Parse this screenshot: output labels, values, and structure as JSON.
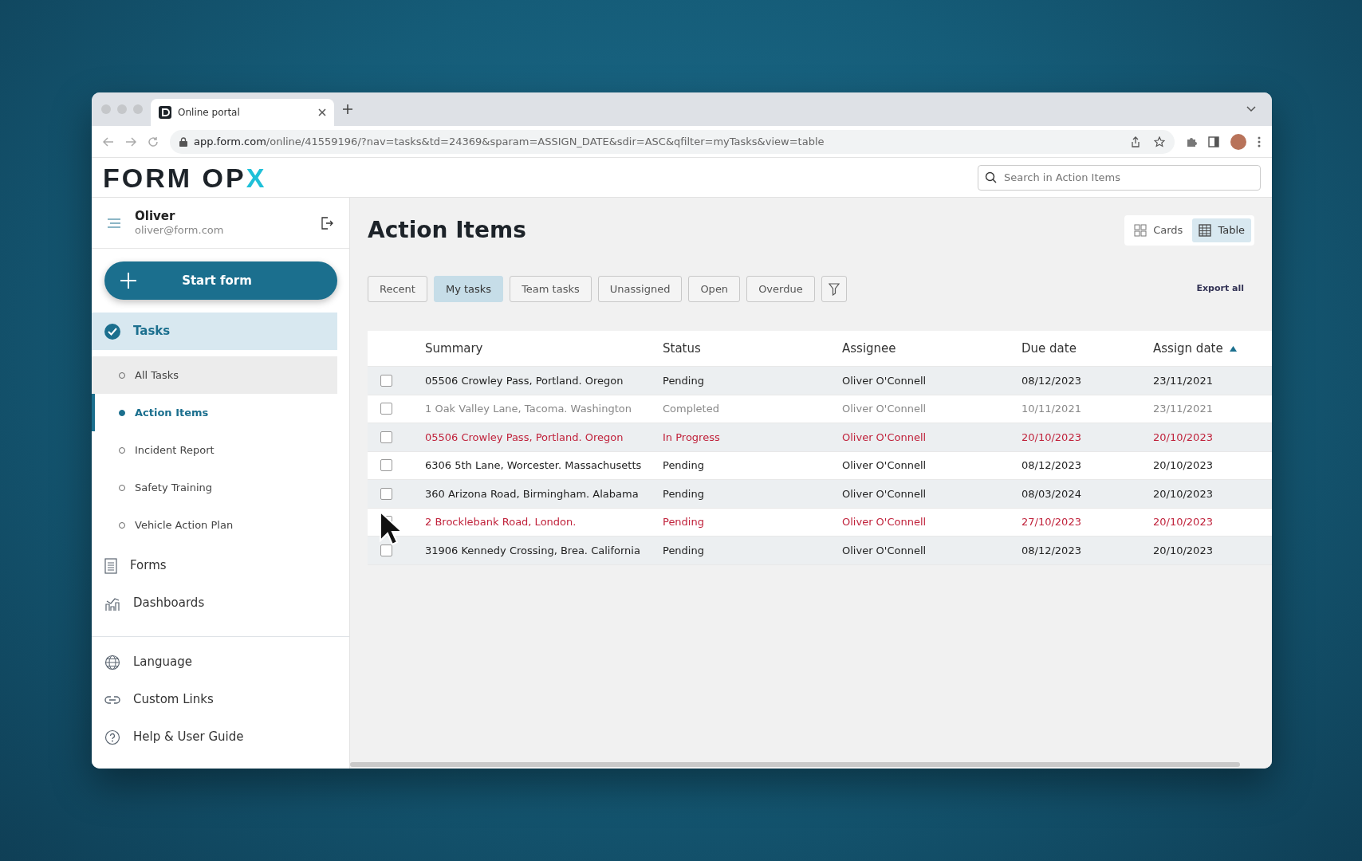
{
  "browser": {
    "tab_title": "Online portal",
    "url_host": "app.form.com",
    "url_path": "/online/41559196/?nav=tasks&td=24369&sparam=ASSIGN_DATE&sdir=ASC&qfilter=myTasks&view=table"
  },
  "header": {
    "logo_main": "FORM OP",
    "logo_mark": "X",
    "search": {
      "placeholder": "Search in Action Items"
    }
  },
  "user": {
    "name": "Oliver",
    "email": "oliver@form.com"
  },
  "start_button": "Start form",
  "sidebar": {
    "items": [
      {
        "label": "Tasks",
        "kind": "tasks",
        "selected": true,
        "children": [
          {
            "label": "All Tasks",
            "selected": false,
            "hovered": true
          },
          {
            "label": "Action Items",
            "selected": true,
            "hovered": false
          },
          {
            "label": "Incident Report",
            "selected": false,
            "hovered": false
          },
          {
            "label": "Safety Training",
            "selected": false,
            "hovered": false
          },
          {
            "label": "Vehicle Action Plan",
            "selected": false,
            "hovered": false
          }
        ]
      },
      {
        "label": "Forms",
        "kind": "forms",
        "selected": false
      },
      {
        "label": "Dashboards",
        "kind": "dashboards",
        "selected": false
      }
    ],
    "footer_items": [
      {
        "label": "Language",
        "kind": "language"
      },
      {
        "label": "Custom Links",
        "kind": "link"
      },
      {
        "label": "Help & User Guide",
        "kind": "help"
      }
    ]
  },
  "page_title": "Action Items",
  "view_toggle": [
    {
      "label": "Cards",
      "kind": "cards",
      "selected": false
    },
    {
      "label": "Table",
      "kind": "table",
      "selected": true
    }
  ],
  "filters": [
    {
      "label": "Recent",
      "selected": false
    },
    {
      "label": "My tasks",
      "selected": true
    },
    {
      "label": "Team tasks",
      "selected": false
    },
    {
      "label": "Unassigned",
      "selected": false
    },
    {
      "label": "Open",
      "selected": false
    },
    {
      "label": "Overdue",
      "selected": false
    }
  ],
  "export_link": "Export all",
  "table": {
    "columns": [
      {
        "label": "Summary",
        "sorted": false
      },
      {
        "label": "Status",
        "sorted": false
      },
      {
        "label": "Assignee",
        "sorted": false
      },
      {
        "label": "Due date",
        "sorted": false
      },
      {
        "label": "Assign date",
        "sorted": true
      }
    ],
    "rows": [
      {
        "kind": "normal",
        "checked": false,
        "cells": [
          "05506 Crowley Pass, Portland. Oregon",
          "Pending",
          "Oliver O'Connell",
          "08/12/2023",
          "23/11/2021"
        ]
      },
      {
        "kind": "completed",
        "checked": false,
        "cells": [
          "1 Oak Valley Lane, Tacoma. Washington",
          "Completed",
          "Oliver O'Connell",
          "10/11/2021",
          "23/11/2021"
        ]
      },
      {
        "kind": "overdue",
        "checked": false,
        "cells": [
          "05506 Crowley Pass, Portland. Oregon",
          "In Progress",
          "Oliver O'Connell",
          "20/10/2023",
          "20/10/2023"
        ]
      },
      {
        "kind": "normal",
        "checked": false,
        "cells": [
          "6306 5th Lane, Worcester. Massachusetts",
          "Pending",
          "Oliver O'Connell",
          "08/12/2023",
          "20/10/2023"
        ]
      },
      {
        "kind": "normal",
        "checked": false,
        "cells": [
          "360 Arizona Road, Birmingham. Alabama",
          "Pending",
          "Oliver O'Connell",
          "08/03/2024",
          "20/10/2023"
        ]
      },
      {
        "kind": "overdue",
        "checked": false,
        "cells": [
          "2 Brocklebank Road, London.",
          "Pending",
          "Oliver O'Connell",
          "27/10/2023",
          "20/10/2023"
        ]
      },
      {
        "kind": "normal",
        "checked": false,
        "cells": [
          "31906 Kennedy Crossing, Brea. California",
          "Pending",
          "Oliver O'Connell",
          "08/12/2023",
          "20/10/2023"
        ]
      }
    ]
  }
}
